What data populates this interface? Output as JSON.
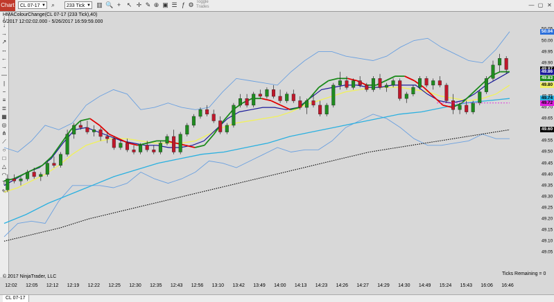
{
  "toolbar": {
    "tab_label": "Chart",
    "instrument": "CL 07-17",
    "interval": "233 Tick",
    "toggle_trades_line1": "Toggle",
    "toggle_trades_line2": "Trades",
    "icons": [
      "bars-icon",
      "search-icon",
      "plus-icon",
      "cursor-icon",
      "crosshair-icon",
      "draw-icon",
      "zoom-icon",
      "scroll-icon",
      "page-icon",
      "image-icon",
      "properties-icon",
      "chart-trader-icon",
      "indicators-icon",
      "strategies-icon",
      "bar-type-icon"
    ]
  },
  "header": {
    "title": "HMAColourChange(CL 07-17 (233 Tick),40)",
    "range": "6/2017 12:02:02.000 - 5/26/2017 16:59:59.000"
  },
  "footer": {
    "copyright": "© 2017 NinjaTrader, LLC",
    "ticks_remaining": "Ticks Remaining = 0",
    "status_tab": "CL 07-17"
  },
  "colors": {
    "background": "#d8d8d8",
    "up_candle": "#1f8c1f",
    "down_candle": "#c0182b",
    "hma_red": "#e00000",
    "hma_green": "#1a8a1a",
    "blue_ma": "#1a1a9a",
    "yellow_ma": "#f0f060",
    "cyan_ma": "#2ab0e0",
    "bollinger": "#6aa0e0",
    "black_ma": "#000000"
  },
  "chart_data": {
    "type": "candlestick",
    "title": "HMAColourChange(CL 07-17 (233 Tick),40)",
    "x_tick_labels": [
      "12:02",
      "12:05",
      "12:12",
      "12:19",
      "12:22",
      "12:25",
      "12:30",
      "12:35",
      "12:43",
      "12:56",
      "13:10",
      "13:42",
      "13:49",
      "14:00",
      "14:13",
      "14:23",
      "14:26",
      "14:27",
      "14:29",
      "14:30",
      "14:49",
      "15:24",
      "15:43",
      "16:06",
      "16:46"
    ],
    "y_tick_labels": [
      "50.05",
      "50.00",
      "49.95",
      "49.90",
      "49.85",
      "49.80",
      "49.75",
      "49.70",
      "49.65",
      "49.60",
      "49.55",
      "49.50",
      "49.45",
      "49.40",
      "49.35",
      "49.30",
      "49.25",
      "49.20",
      "49.15",
      "49.10",
      "49.05"
    ],
    "ylim": [
      49.02,
      50.07
    ],
    "price_markers": [
      {
        "label": "50.04",
        "value": 50.04,
        "bg": "#2a6edb",
        "fg": "#ffffff"
      },
      {
        "label": "49.87",
        "value": 49.87,
        "bg": "#000000",
        "fg": "#ffffff"
      },
      {
        "label": "49.86",
        "value": 49.86,
        "bg": "#1a1a9a",
        "fg": "#ffffff"
      },
      {
        "label": "49.83",
        "value": 49.83,
        "bg": "#1a8a1a",
        "fg": "#ffffff"
      },
      {
        "label": "49.80",
        "value": 49.8,
        "bg": "#f0f060",
        "fg": "#000000"
      },
      {
        "label": "49.74",
        "value": 49.74,
        "bg": "#2ab0e0",
        "fg": "#000000"
      },
      {
        "label": "49.72",
        "value": 49.72,
        "bg": "#e020e0",
        "fg": "#000000"
      },
      {
        "label": "49.60",
        "value": 49.6,
        "bg": "#000000",
        "fg": "#ffffff"
      }
    ],
    "candles": [
      [
        49.33,
        49.4,
        49.32,
        49.38
      ],
      [
        49.38,
        49.4,
        49.36,
        49.37
      ],
      [
        49.37,
        49.39,
        49.35,
        49.38
      ],
      [
        49.38,
        49.42,
        49.37,
        49.41
      ],
      [
        49.41,
        49.43,
        49.38,
        49.39
      ],
      [
        49.39,
        49.41,
        49.37,
        49.4
      ],
      [
        49.4,
        49.46,
        49.39,
        49.45
      ],
      [
        49.45,
        49.48,
        49.43,
        49.44
      ],
      [
        49.44,
        49.5,
        49.43,
        49.49
      ],
      [
        49.49,
        49.6,
        49.48,
        49.58
      ],
      [
        49.58,
        49.63,
        49.56,
        49.62
      ],
      [
        49.62,
        49.64,
        49.6,
        49.61
      ],
      [
        49.61,
        49.64,
        49.58,
        49.59
      ],
      [
        49.59,
        49.62,
        49.57,
        49.6
      ],
      [
        49.6,
        49.61,
        49.55,
        49.57
      ],
      [
        49.57,
        49.59,
        49.54,
        49.56
      ],
      [
        49.56,
        49.57,
        49.51,
        49.52
      ],
      [
        49.52,
        49.55,
        49.51,
        49.54
      ],
      [
        49.54,
        49.56,
        49.5,
        49.51
      ],
      [
        49.51,
        49.53,
        49.49,
        49.5
      ],
      [
        49.5,
        49.54,
        49.49,
        49.53
      ],
      [
        49.53,
        49.55,
        49.5,
        49.51
      ],
      [
        49.51,
        49.53,
        49.49,
        49.5
      ],
      [
        49.5,
        49.55,
        49.49,
        49.54
      ],
      [
        49.54,
        49.58,
        49.53,
        49.57
      ],
      [
        49.57,
        49.6,
        49.49,
        49.5
      ],
      [
        49.5,
        49.59,
        49.49,
        49.58
      ],
      [
        49.58,
        49.63,
        49.57,
        49.62
      ],
      [
        49.62,
        49.67,
        49.61,
        49.66
      ],
      [
        49.66,
        49.7,
        49.65,
        49.69
      ],
      [
        49.69,
        49.71,
        49.66,
        49.67
      ],
      [
        49.67,
        49.69,
        49.63,
        49.64
      ],
      [
        49.64,
        49.66,
        49.58,
        49.59
      ],
      [
        49.59,
        49.63,
        49.58,
        49.62
      ],
      [
        49.62,
        49.72,
        49.61,
        49.71
      ],
      [
        49.71,
        49.76,
        49.7,
        49.74
      ],
      [
        49.74,
        49.76,
        49.7,
        49.71
      ],
      [
        49.71,
        49.77,
        49.7,
        49.76
      ],
      [
        49.76,
        49.78,
        49.74,
        49.75
      ],
      [
        49.75,
        49.79,
        49.74,
        49.78
      ],
      [
        49.78,
        49.8,
        49.74,
        49.75
      ],
      [
        49.75,
        49.78,
        49.72,
        49.73
      ],
      [
        49.73,
        49.77,
        49.72,
        49.76
      ],
      [
        49.76,
        49.78,
        49.72,
        49.73
      ],
      [
        49.73,
        49.75,
        49.69,
        49.7
      ],
      [
        49.7,
        49.74,
        49.67,
        49.73
      ],
      [
        49.73,
        49.76,
        49.7,
        49.71
      ],
      [
        49.71,
        49.73,
        49.66,
        49.67
      ],
      [
        49.67,
        49.72,
        49.66,
        49.71
      ],
      [
        49.71,
        49.81,
        49.7,
        49.8
      ],
      [
        49.8,
        49.86,
        49.78,
        49.82
      ],
      [
        49.82,
        49.84,
        49.78,
        49.79
      ],
      [
        49.79,
        49.83,
        49.78,
        49.82
      ],
      [
        49.82,
        49.84,
        49.79,
        49.8
      ],
      [
        49.8,
        49.81,
        49.77,
        49.78
      ],
      [
        49.78,
        49.84,
        49.77,
        49.83
      ],
      [
        49.83,
        49.85,
        49.78,
        49.79
      ],
      [
        49.79,
        49.81,
        49.77,
        49.8
      ],
      [
        49.8,
        49.83,
        49.79,
        49.82
      ],
      [
        49.82,
        49.83,
        49.73,
        49.74
      ],
      [
        49.74,
        49.77,
        49.72,
        49.76
      ],
      [
        49.76,
        49.8,
        49.75,
        49.79
      ],
      [
        49.79,
        49.84,
        49.78,
        49.83
      ],
      [
        49.83,
        49.84,
        49.79,
        49.8
      ],
      [
        49.8,
        49.83,
        49.78,
        49.82
      ],
      [
        49.82,
        49.84,
        49.79,
        49.8
      ],
      [
        49.8,
        49.81,
        49.72,
        49.73
      ],
      [
        49.73,
        49.76,
        49.67,
        49.69
      ],
      [
        49.69,
        49.72,
        49.67,
        49.71
      ],
      [
        49.71,
        49.73,
        49.67,
        49.68
      ],
      [
        49.68,
        49.73,
        49.67,
        49.72
      ],
      [
        49.72,
        49.78,
        49.71,
        49.77
      ],
      [
        49.77,
        49.84,
        49.76,
        49.83
      ],
      [
        49.83,
        49.91,
        49.82,
        49.89
      ],
      [
        49.89,
        49.94,
        49.86,
        49.92
      ],
      [
        49.92,
        49.93,
        49.85,
        49.87
      ]
    ],
    "series": [
      {
        "name": "HMA",
        "values": [
          49.37,
          49.38,
          49.4,
          49.42,
          49.44,
          49.48,
          49.54,
          49.6,
          49.64,
          49.65,
          49.62,
          49.58,
          49.56,
          49.54,
          49.53,
          49.54,
          49.55,
          49.55,
          49.54,
          49.53,
          49.52,
          49.53,
          49.58,
          49.64,
          49.69,
          49.72,
          49.74,
          49.74,
          49.73,
          49.71,
          49.69,
          49.7,
          49.74,
          49.79,
          49.82,
          49.83,
          49.83,
          49.82,
          49.8,
          49.8,
          49.82,
          49.84,
          49.84,
          49.82,
          49.79,
          49.75,
          49.71,
          49.7,
          49.72,
          49.76,
          49.8,
          49.84,
          49.86,
          49.86
        ]
      },
      {
        "name": "Blue MA",
        "values": [
          49.35,
          49.38,
          49.41,
          49.43,
          49.47,
          49.54,
          49.6,
          49.61,
          49.59,
          49.57,
          49.55,
          49.54,
          49.53,
          49.53,
          49.52,
          49.52,
          49.53,
          49.55,
          49.6,
          49.65,
          49.68,
          49.69,
          49.7,
          49.7,
          49.69,
          49.7,
          49.74,
          49.78,
          49.79,
          49.8,
          49.8,
          49.79,
          49.79,
          49.8,
          49.8,
          49.8,
          49.76,
          49.73,
          49.72,
          49.73,
          49.76,
          49.8,
          49.83,
          49.86
        ]
      },
      {
        "name": "Yellow MA",
        "values": [
          49.32,
          49.34,
          49.37,
          49.4,
          49.44,
          49.49,
          49.53,
          49.55,
          49.56,
          49.56,
          49.55,
          49.54,
          49.54,
          49.54,
          49.55,
          49.58,
          49.61,
          49.63,
          49.64,
          49.65,
          49.66,
          49.68,
          49.71,
          49.73,
          49.75,
          49.77,
          49.78,
          49.79,
          49.79,
          49.79,
          49.78,
          49.77,
          49.75,
          49.74,
          49.73,
          49.74,
          49.76,
          49.8
        ]
      },
      {
        "name": "Cyan MA",
        "values": [
          49.18,
          49.22,
          49.27,
          49.31,
          49.35,
          49.39,
          49.42,
          49.45,
          49.47,
          49.49,
          49.5,
          49.52,
          49.54,
          49.57,
          49.59,
          49.61,
          49.63,
          49.65,
          49.67,
          49.68,
          49.7,
          49.72,
          49.73,
          49.74
        ]
      },
      {
        "name": "Black MA",
        "values": [
          49.1,
          49.13,
          49.16,
          49.2,
          49.23,
          49.26,
          49.29,
          49.32,
          49.35,
          49.38,
          49.41,
          49.44,
          49.47,
          49.5,
          49.52,
          49.54,
          49.56,
          49.58,
          49.6
        ]
      }
    ]
  }
}
